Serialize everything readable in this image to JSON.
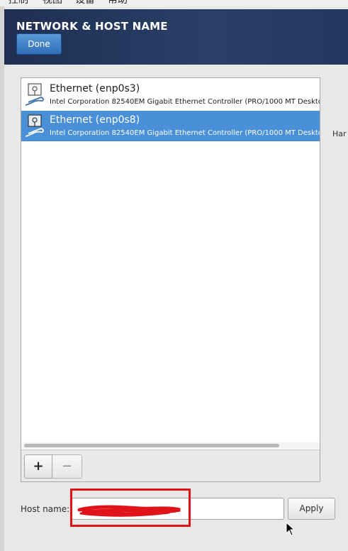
{
  "menubar": {
    "items": [
      {
        "label": "控制"
      },
      {
        "label": "视图"
      },
      {
        "label": "设备"
      },
      {
        "label": "帮助"
      }
    ]
  },
  "header": {
    "title": "NETWORK & HOST NAME",
    "done_label": "Done"
  },
  "devices": [
    {
      "name": "Ethernet (enp0s3)",
      "description": "Intel Corporation 82540EM Gigabit Ethernet Controller (PRO/1000 MT Deskto",
      "icon": "network-wired-icon",
      "selected": false
    },
    {
      "name": "Ethernet (enp0s8)",
      "description": "Intel Corporation 82540EM Gigabit Ethernet Controller (PRO/1000 MT Deskto",
      "icon": "network-wired-icon",
      "selected": true
    }
  ],
  "list_toolbar": {
    "add_label": "+",
    "remove_label": "−"
  },
  "detail": {
    "hardware_label": "Har"
  },
  "hostname": {
    "label": "Host name:",
    "value": "",
    "apply_label": "Apply"
  },
  "colors": {
    "selection": "#4a90d9",
    "header_bg": "#1e2f52",
    "annotation_red": "#e0131b",
    "done_button": "#2f6fb7"
  }
}
